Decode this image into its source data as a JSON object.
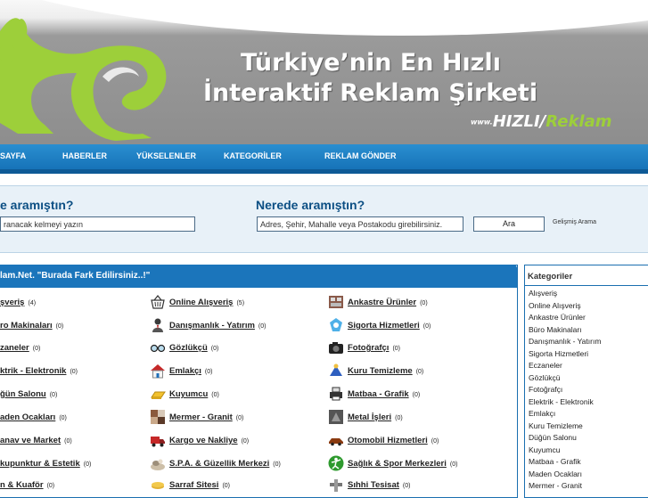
{
  "banner": {
    "headline_line1": "Türkiye’nin En Hızlı",
    "headline_line2": "İnteraktif Reklam Şirketi",
    "brand_www": "www.",
    "brand_hizli": "HIZLI",
    "brand_slash": "/",
    "brand_reklam": "Reklam"
  },
  "nav": {
    "items": [
      "SAYFA",
      "HABERLER",
      "YÜKSELENLER",
      "KATEGORİLER",
      "REKLAM GÖNDER"
    ]
  },
  "search": {
    "what_label": "e aramıştın?",
    "where_label": "Nerede aramıştın?",
    "what_placeholder": "ranacak kelmeyi yazın",
    "where_placeholder": "Adres, Şehir, Mahalle veya Postakodu girebilirsiniz.",
    "button_label": "Ara",
    "advanced_label": "Gelişmiş Arama"
  },
  "main": {
    "title": "lam.Net. \"Burada Fark Edilirsiniz..!\"",
    "col1": [
      {
        "name": "şveriş",
        "count": "(4)"
      },
      {
        "name": "ro Makinaları",
        "count": "(0)"
      },
      {
        "name": "zaneler",
        "count": "(0)"
      },
      {
        "name": "ktrik - Elektronik",
        "count": "(0)"
      },
      {
        "name": "ğün Salonu",
        "count": "(0)"
      },
      {
        "name": "aden Ocakları",
        "count": "(0)"
      },
      {
        "name": "anav ve Market",
        "count": "(0)"
      },
      {
        "name": "kupunktur & Estetik",
        "count": "(0)"
      },
      {
        "name": "n & Kuaför",
        "count": "(0)"
      }
    ],
    "col2": [
      {
        "name": "Online Alışveriş",
        "count": "(5)",
        "icon": "basket-icon"
      },
      {
        "name": "Danışmanlık - Yatırım",
        "count": "(0)",
        "icon": "consultant-icon"
      },
      {
        "name": "Gözlükçü",
        "count": "(0)",
        "icon": "glasses-icon"
      },
      {
        "name": "Emlakçı",
        "count": "(0)",
        "icon": "house-icon"
      },
      {
        "name": "Kuyumcu",
        "count": "(0)",
        "icon": "gold-bar-icon"
      },
      {
        "name": "Mermer - Granit",
        "count": "(0)",
        "icon": "marble-icon"
      },
      {
        "name": "Kargo ve Nakliye",
        "count": "(0)",
        "icon": "truck-icon"
      },
      {
        "name": "S.P.A. & Güzellik Merkezi",
        "count": "(0)",
        "icon": "spa-icon"
      },
      {
        "name": "Sarraf Sitesi",
        "count": "(0)",
        "icon": "coins-icon"
      }
    ],
    "col3": [
      {
        "name": "Ankastre Ürünler",
        "count": "(0)",
        "icon": "kitchen-icon"
      },
      {
        "name": "Sigorta Hizmetleri",
        "count": "(0)",
        "icon": "insurance-icon"
      },
      {
        "name": "Fotoğrafçı",
        "count": "(0)",
        "icon": "camera-icon"
      },
      {
        "name": "Kuru Temizleme",
        "count": "(0)",
        "icon": "cleaning-icon"
      },
      {
        "name": "Matbaa - Grafik",
        "count": "(0)",
        "icon": "printer-icon"
      },
      {
        "name": "Metal İşleri",
        "count": "(0)",
        "icon": "metal-icon"
      },
      {
        "name": "Otomobil Hizmetleri",
        "count": "(0)",
        "icon": "car-icon"
      },
      {
        "name": "Sağlık & Spor Merkezleri",
        "count": "(0)",
        "icon": "fitness-icon"
      },
      {
        "name": "Sıhhi Tesisat",
        "count": "(0)",
        "icon": "plumbing-icon"
      }
    ]
  },
  "sidebar": {
    "title": "Kategoriler",
    "items": [
      "Alışveriş",
      "Online Alışveriş",
      "Ankastre Ürünler",
      "Büro Makinaları",
      "Danışmanlık - Yatırım",
      "Sigorta Hizmetleri",
      "Eczaneler",
      "Gözlükçü",
      "Fotoğrafçı",
      "Elektrik - Elektronik",
      "Emlakçı",
      "Kuru Temizleme",
      "Düğün Salonu",
      "Kuyumcu",
      "Matbaa - Grafik",
      "Maden Ocakları",
      "Mermer - Granit"
    ]
  },
  "colors": {
    "nav_blue": "#1b75bb",
    "brand_green": "#9dcf3a",
    "label_blue": "#0c4f84"
  }
}
